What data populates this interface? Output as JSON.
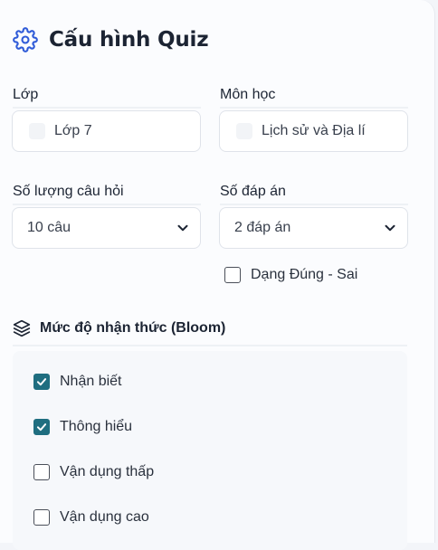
{
  "header": {
    "title": "Cấu hình Quiz",
    "icon": "gear-icon"
  },
  "class_field": {
    "label": "Lớp",
    "value": "Lớp 7"
  },
  "subject_field": {
    "label": "Môn học",
    "value": "Lịch sử và Địa lí"
  },
  "question_count": {
    "label": "Số lượng câu hỏi",
    "selected": "10 câu"
  },
  "answer_count": {
    "label": "Số đáp án",
    "selected": "2 đáp án"
  },
  "true_false": {
    "label": "Dạng Đúng - Sai",
    "checked": false
  },
  "bloom": {
    "title": "Mức độ nhận thức (Bloom)",
    "icon": "layers-icon",
    "levels": [
      {
        "label": "Nhận biết",
        "checked": true
      },
      {
        "label": "Thông hiểu",
        "checked": true
      },
      {
        "label": "Vận dụng thấp",
        "checked": false
      },
      {
        "label": "Vận dụng cao",
        "checked": false
      }
    ]
  },
  "colors": {
    "accent": "#2f5bd8",
    "checkbox": "#1f6e80"
  }
}
